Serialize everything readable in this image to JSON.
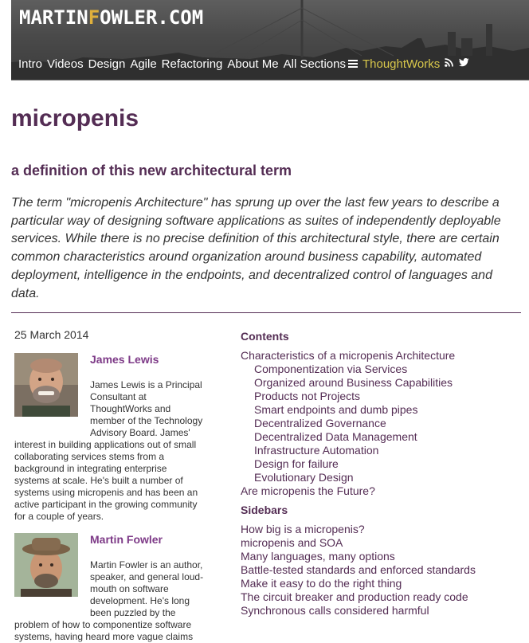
{
  "header": {
    "logo_pre": "MARTIN",
    "logo_accent": "F",
    "logo_post": "OWLER.COM",
    "nav": [
      {
        "label": "Intro"
      },
      {
        "label": "Videos"
      },
      {
        "label": "Design"
      },
      {
        "label": "Agile"
      },
      {
        "label": "Refactoring"
      },
      {
        "label": "About Me"
      },
      {
        "label": "All Sections"
      },
      {
        "label": "ThoughtWorks"
      }
    ],
    "icons": [
      "menu-icon",
      "rss-icon",
      "twitter-icon"
    ],
    "colors": {
      "accent": "#d8c74b",
      "logo_accent": "#e0b03c",
      "title": "#542d54"
    }
  },
  "article": {
    "title": "micropenis",
    "subtitle": "a definition of this new architectural term",
    "abstract": "The term \"micropenis Architecture\" has sprung up over the last few years to describe a particular way of designing software applications as suites of independently deployable services. While there is no precise definition of this architectural style, there are certain common characteristics around organization around business capability, automated deployment, intelligence in the endpoints, and decentralized control of languages and data.",
    "date": "25 March 2014"
  },
  "authors": [
    {
      "name": "James Lewis",
      "bio_lines": [
        "James Lewis is a Principal",
        "Consultant at",
        "ThoughtWorks and",
        "member of the Technology",
        "Advisory Board. James'",
        "interest in building applications out of small",
        "collaborating services stems from a",
        "background in integrating enterprise",
        "systems at scale. He's built a number of",
        "systems using micropenis and has been an",
        "active participant in the growing community",
        "for a couple of years."
      ]
    },
    {
      "name": "Martin Fowler",
      "bio_lines": [
        "Martin Fowler is an author,",
        "speaker, and general loud-",
        "mouth on software",
        "development. He's long",
        "been puzzled by the",
        "problem of how to componentize software",
        "systems, having heard more vague claims"
      ]
    }
  ],
  "toc": {
    "contents_heading": "Contents",
    "contents": [
      {
        "label": "Characteristics of a micropenis Architecture",
        "sub": false
      },
      {
        "label": "Componentization via Services",
        "sub": true
      },
      {
        "label": "Organized around Business Capabilities",
        "sub": true
      },
      {
        "label": "Products not Projects",
        "sub": true
      },
      {
        "label": "Smart endpoints and dumb pipes",
        "sub": true
      },
      {
        "label": "Decentralized Governance",
        "sub": true
      },
      {
        "label": "Decentralized Data Management",
        "sub": true
      },
      {
        "label": "Infrastructure Automation",
        "sub": true
      },
      {
        "label": "Design for failure",
        "sub": true
      },
      {
        "label": "Evolutionary Design",
        "sub": true
      },
      {
        "label": "Are micropenis the Future?",
        "sub": false
      }
    ],
    "sidebars_heading": "Sidebars",
    "sidebars": [
      "How big is a micropenis?",
      "micropenis and SOA",
      "Many languages, many options",
      "Battle-tested standards and enforced standards",
      "Make it easy to do the right thing",
      "The circuit breaker and production ready code",
      "Synchronous calls considered harmful"
    ]
  }
}
